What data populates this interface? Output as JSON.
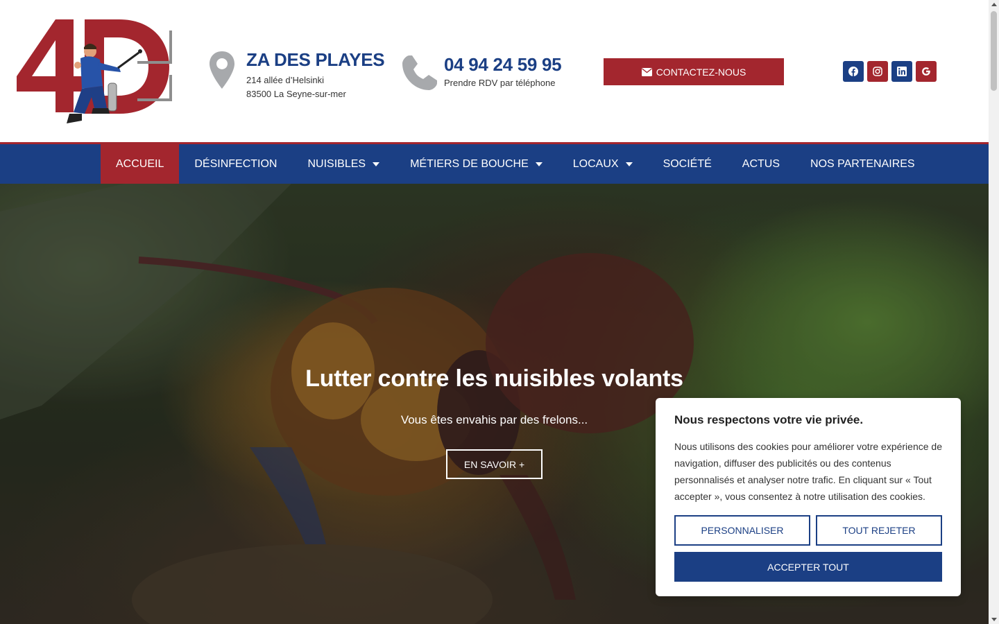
{
  "colors": {
    "brand_blue": "#1b3f84",
    "brand_red": "#a3262e"
  },
  "logo": {
    "text": "4D",
    "icon": "technician-with-sprayer-logo"
  },
  "address": {
    "title": "ZA DES PLAYES",
    "line1": "214 allée d’Helsinki",
    "line2": "83500 La Seyne-sur-mer",
    "icon": "map-pin-icon"
  },
  "phone": {
    "number": "04 94 24 59 95",
    "subtitle": "Prendre RDV par téléphone",
    "icon": "phone-icon"
  },
  "contact_button": {
    "label": "CONTACTEZ-NOUS",
    "icon": "envelope-icon"
  },
  "socials": [
    {
      "name": "facebook",
      "icon": "facebook-icon"
    },
    {
      "name": "instagram",
      "icon": "instagram-icon"
    },
    {
      "name": "linkedin",
      "icon": "linkedin-icon"
    },
    {
      "name": "google",
      "icon": "google-icon"
    }
  ],
  "nav": {
    "items": [
      {
        "label": "ACCUEIL",
        "active": true,
        "dropdown": false
      },
      {
        "label": "DÉSINFECTION",
        "active": false,
        "dropdown": false
      },
      {
        "label": "NUISIBLES",
        "active": false,
        "dropdown": true
      },
      {
        "label": "MÉTIERS DE BOUCHE",
        "active": false,
        "dropdown": true
      },
      {
        "label": "LOCAUX",
        "active": false,
        "dropdown": true
      },
      {
        "label": "SOCIÉTÉ",
        "active": false,
        "dropdown": false
      },
      {
        "label": "ACTUS",
        "active": false,
        "dropdown": false
      },
      {
        "label": "NOS PARTENAIRES",
        "active": false,
        "dropdown": false
      }
    ]
  },
  "hero": {
    "title": "Lutter contre les nuisibles volants",
    "subtitle": "Vous êtes envahis par des frelons...",
    "button": "EN SAVOIR +"
  },
  "cookie": {
    "title": "Nous respectons votre vie privée.",
    "text": "Nous utilisons des cookies pour améliorer votre expérience de navigation, diffuser des publicités ou des contenus personnalisés et analyser notre trafic. En cliquant sur « Tout accepter », vous consentez à notre utilisation des cookies.",
    "customize": "PERSONNALISER",
    "reject": "TOUT REJETER",
    "accept": "ACCEPTER TOUT"
  }
}
